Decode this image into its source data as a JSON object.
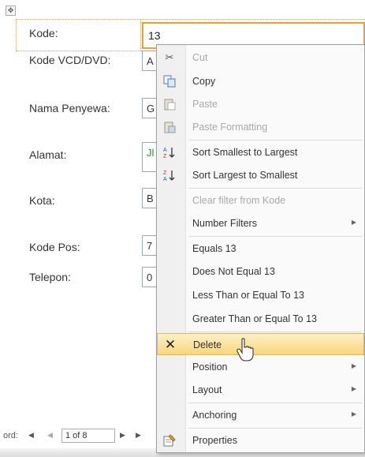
{
  "form": {
    "fields": [
      {
        "label": "Kode:",
        "value": "13"
      },
      {
        "label": "Kode VCD/DVD:",
        "value": "A"
      },
      {
        "label": "Nama Penyewa:",
        "value": "G"
      },
      {
        "label": "Alamat:",
        "value": "Jl"
      },
      {
        "label": "Kota:",
        "value": "B"
      },
      {
        "label": "Kode Pos:",
        "value": "7"
      },
      {
        "label": "Telepon:",
        "value": "0"
      }
    ]
  },
  "nav": {
    "prefix": "ord:",
    "first": "◀",
    "prev": "◀",
    "position": "1 of 8",
    "next": "▶",
    "last": "▶"
  },
  "context_menu": {
    "items": [
      {
        "label": "Cut",
        "icon": "scissors-icon",
        "disabled": true
      },
      {
        "label": "Copy",
        "icon": "copy-icon",
        "disabled": false
      },
      {
        "label": "Paste",
        "icon": "paste-icon",
        "disabled": true
      },
      {
        "label": "Paste Formatting",
        "icon": "paste-formatting-icon",
        "disabled": true
      },
      {
        "label": "Sort Smallest to Largest",
        "icon": "sort-ascending-icon",
        "disabled": false
      },
      {
        "label": "Sort Largest to Smallest",
        "icon": "sort-descending-icon",
        "disabled": false
      },
      {
        "label": "Clear filter from Kode",
        "disabled": true
      },
      {
        "label": "Number Filters",
        "submenu": true
      },
      {
        "label": "Equals 13"
      },
      {
        "label": "Does Not Equal 13"
      },
      {
        "label": "Less Than or Equal To 13"
      },
      {
        "label": "Greater Than or Equal To 13"
      },
      {
        "label": "Delete",
        "icon": "delete-x-icon",
        "highlighted": true
      },
      {
        "label": "Position",
        "submenu": true
      },
      {
        "label": "Layout",
        "submenu": true
      },
      {
        "label": "Anchoring",
        "submenu": true
      },
      {
        "label": "Properties",
        "icon": "properties-icon"
      }
    ]
  },
  "colors": {
    "active_border": "#e8a03c",
    "highlight_top": "#fdf0c8",
    "highlight_bottom": "#f8d77a",
    "sort_icon_blue": "#2060c0",
    "sort_icon_red": "#c03030"
  }
}
